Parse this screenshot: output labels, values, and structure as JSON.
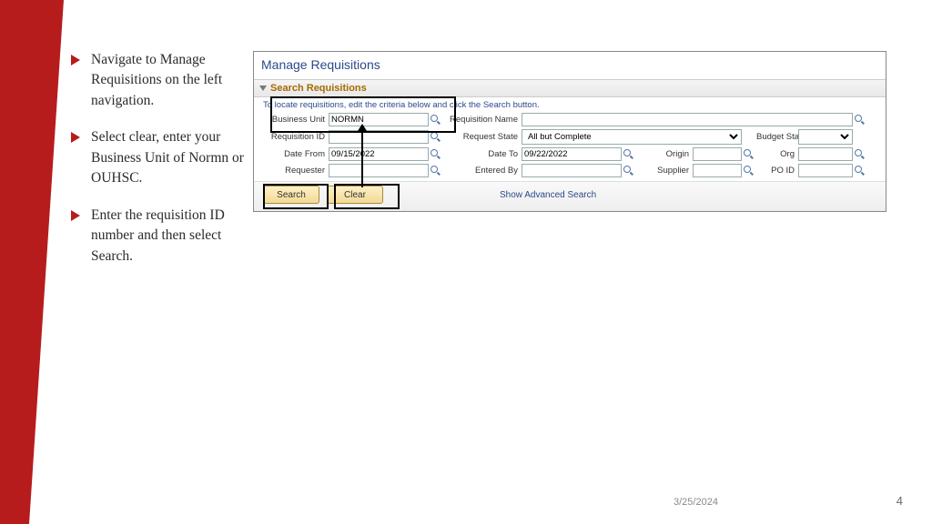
{
  "bullets": [
    "Navigate to Manage Requisitions on the left navigation.",
    "Select clear, enter your Business Unit of Normn or OUHSC.",
    "Enter the requisition ID number and then select Search."
  ],
  "app": {
    "title": "Manage Requisitions",
    "section": "Search Requisitions",
    "instruction": "To locate requisitions, edit the criteria below and click the Search button.",
    "labels": {
      "business_unit": "Business Unit",
      "requisition_id": "Requisition ID",
      "date_from": "Date From",
      "requester": "Requester",
      "requisition_name": "Requisition Name",
      "request_state": "Request State",
      "date_to": "Date To",
      "entered_by": "Entered By",
      "budget_status": "Budget Status",
      "origin": "Origin",
      "org": "Org",
      "supplier": "Supplier",
      "po_id": "PO ID"
    },
    "values": {
      "business_unit": "NORMN",
      "requisition_id": "",
      "date_from": "09/15/2022",
      "requester": "",
      "requisition_name": "",
      "request_state": "All but Complete",
      "date_to": "09/22/2022",
      "entered_by": "",
      "budget_status": "",
      "origin": "",
      "org": "",
      "supplier": "",
      "po_id": ""
    },
    "buttons": {
      "search": "Search",
      "clear": "Clear"
    },
    "advanced": "Show Advanced Search"
  },
  "footer": {
    "date": "3/25/2024",
    "page": "4"
  }
}
